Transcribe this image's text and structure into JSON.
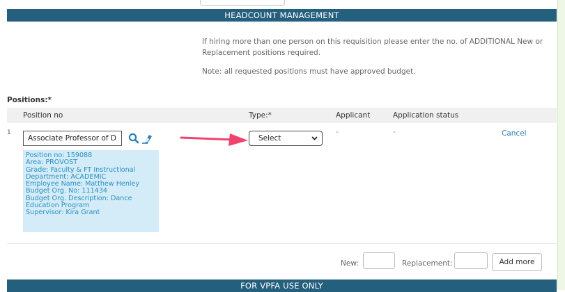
{
  "headcount": {
    "title": "HEADCOUNT MANAGEMENT",
    "info_line1": "If hiring more than one person on this requisition please enter the no. of ADDITIONAL New or",
    "info_line2": "Replacement positions required.",
    "note": "Note: all requested positions must have approved budget."
  },
  "positions": {
    "label": "Positions:*",
    "columns": [
      "Position no",
      "Type:*",
      "Applicant",
      "Application status"
    ],
    "rows": [
      {
        "index": "1",
        "position_value": "Associate Professor of D",
        "type_selected": "Select",
        "applicant": "-",
        "application_status": "-",
        "cancel_label": "Cancel",
        "details": [
          "Position no: 159088",
          "Area: PROVOST",
          "Grade: Faculty & FT Instructional",
          "Department: ACADEMIC",
          "Employee Name: Matthew Henley",
          "Budget Org. No: 111434",
          "Budget Org. Description: Dance Education Program",
          "Supervisor: Kira Grant"
        ]
      }
    ]
  },
  "add_more": {
    "new_label": "New:",
    "new_value": "",
    "replacement_label": "Replacement:",
    "replacement_value": "",
    "button_label": "Add more"
  },
  "vpfa": {
    "title": "FOR VPFA USE ONLY"
  },
  "colors": {
    "section_bar": "#255f7e",
    "details_bg": "#d4ecf7",
    "details_text": "#2a8fc6",
    "arrow": "#f0436e",
    "link": "#2a7fb8"
  },
  "icons": [
    "search-icon",
    "eraser-icon",
    "chevron-down-icon",
    "annotation-arrow-icon"
  ]
}
